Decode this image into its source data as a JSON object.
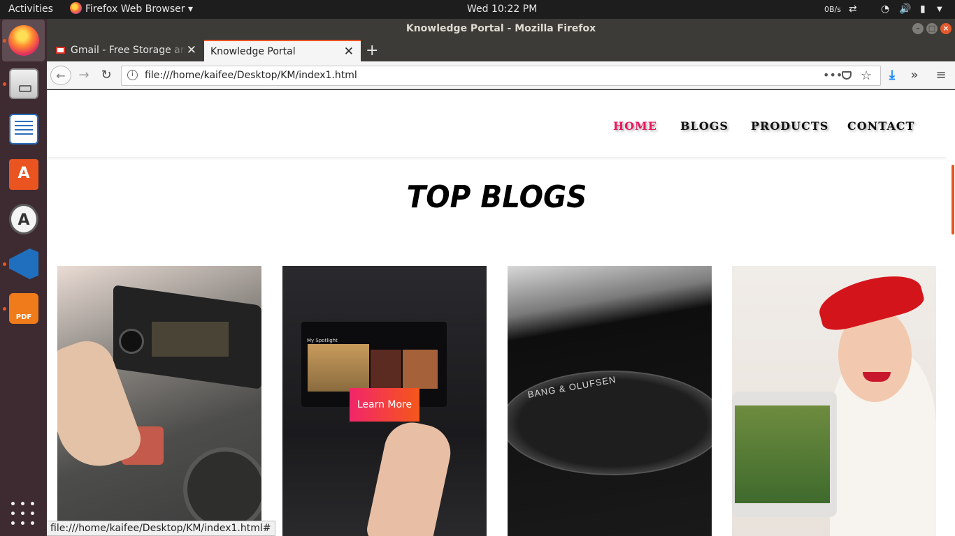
{
  "system_bar": {
    "activities": "Activities",
    "app_menu": "Firefox Web Browser",
    "clock": "Wed 10:22 PM",
    "net_speed": "0B/s"
  },
  "dock": {
    "items": [
      "firefox",
      "files",
      "libreoffice-writer",
      "ubuntu-software",
      "software-updater",
      "vscode",
      "pdf-editor"
    ],
    "accent": "#e95420"
  },
  "window": {
    "title": "Knowledge Portal - Mozilla Firefox"
  },
  "tabs": [
    {
      "label": "Gmail - Free Storage and Email from Google",
      "active": false
    },
    {
      "label": "Knowledge Portal",
      "active": true
    }
  ],
  "navbar": {
    "url": "file:///home/kaifee/Desktop/KM/index1.html"
  },
  "site": {
    "nav": [
      "HOME",
      "BLOGS",
      "PRODUCTS",
      "CONTACT"
    ],
    "nav_active_color": "#e8175d",
    "section_title": "TOP BLOGS",
    "card_button": "Learn More",
    "card_brand_text": "BANG & OLUFSEN",
    "card_screen_text": "My Spotlight"
  },
  "status_bar": {
    "link_preview": "file:///home/kaifee/Desktop/KM/index1.html#"
  }
}
